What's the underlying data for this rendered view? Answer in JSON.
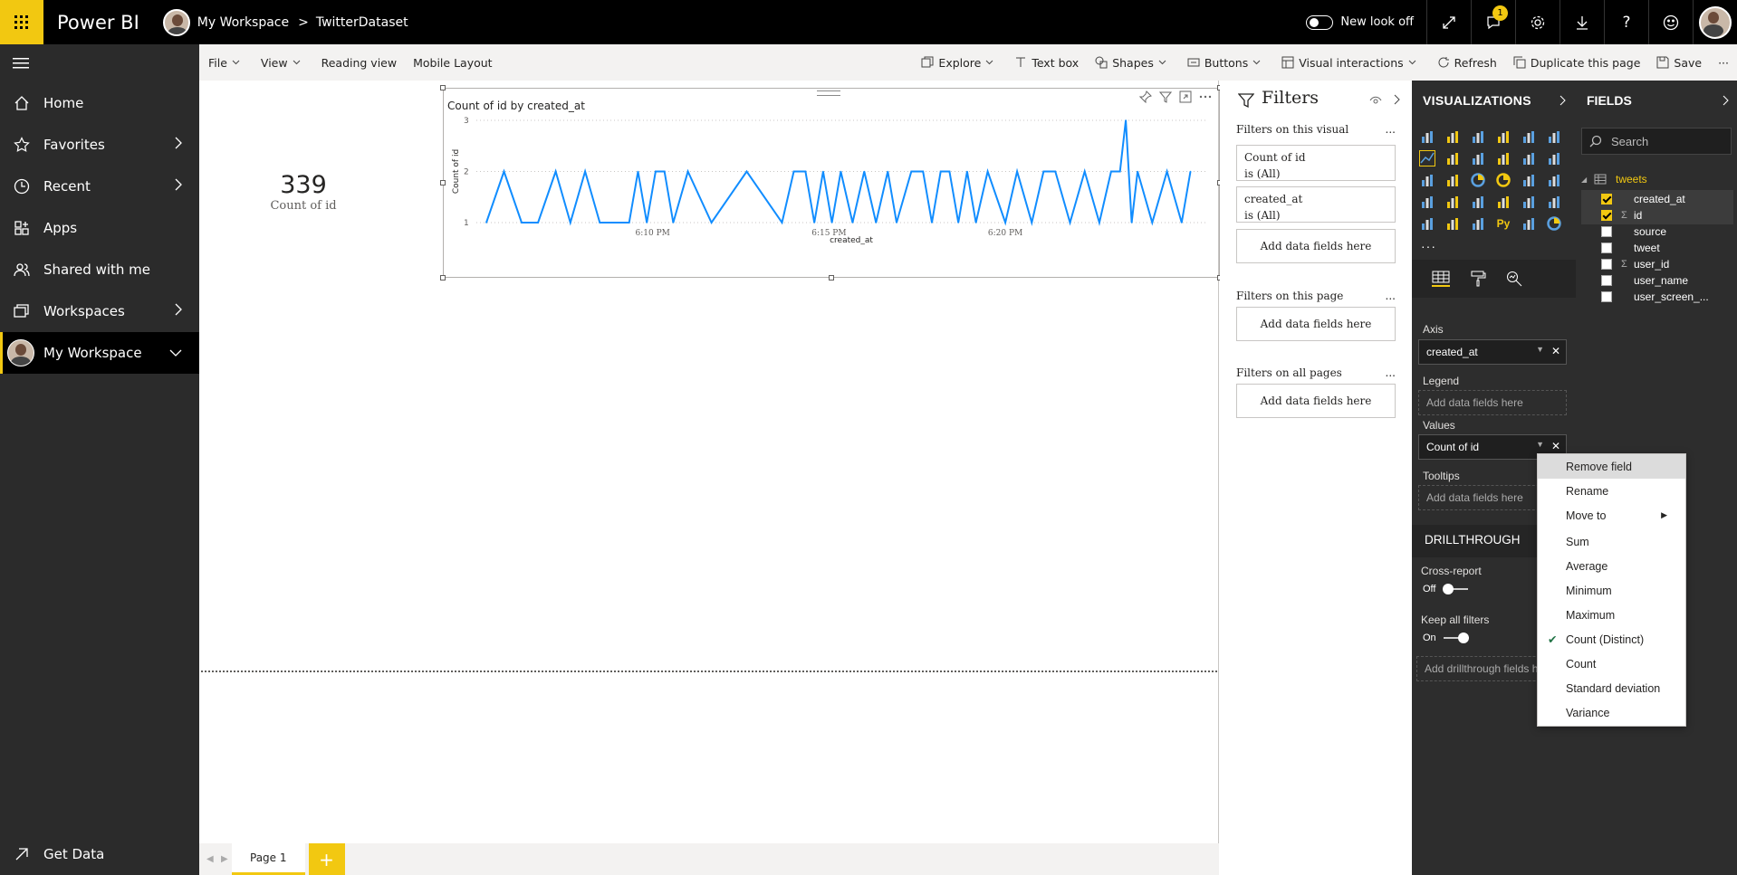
{
  "topbar": {
    "brand": "Power BI",
    "workspace": "My Workspace",
    "separator": ">",
    "dataset": "TwitterDataset",
    "new_look_label": "New look off",
    "notification_count": "1"
  },
  "nav": {
    "items": [
      {
        "label": "Home",
        "icon": "home-icon"
      },
      {
        "label": "Favorites",
        "icon": "star-icon"
      },
      {
        "label": "Recent",
        "icon": "clock-icon"
      },
      {
        "label": "Apps",
        "icon": "apps-icon"
      },
      {
        "label": "Shared with me",
        "icon": "shared-icon"
      },
      {
        "label": "Workspaces",
        "icon": "workspaces-icon"
      },
      {
        "label": "My Workspace",
        "icon": "avatar"
      }
    ],
    "get_data": "Get Data"
  },
  "ribbon": {
    "file": "File",
    "view": "View",
    "reading_view": "Reading view",
    "mobile_layout": "Mobile Layout",
    "explore": "Explore",
    "text_box": "Text box",
    "shapes": "Shapes",
    "buttons": "Buttons",
    "visual_interactions": "Visual interactions",
    "refresh": "Refresh",
    "duplicate": "Duplicate this page",
    "save": "Save",
    "more": "···"
  },
  "card": {
    "value": "339",
    "label": "Count of id"
  },
  "chart_data": {
    "type": "line",
    "title": "Count of id by created_at",
    "xlabel": "created_at",
    "ylabel": "Count of id",
    "yticks": [
      "1",
      "2",
      "3"
    ],
    "xticks": [
      "6:10 PM",
      "6:15 PM",
      "6:20 PM"
    ],
    "ylim": [
      1,
      3
    ],
    "series_color": "#118dff",
    "x": [
      "6:05:17",
      "6:05:47",
      "6:06:17",
      "6:06:45",
      "6:07:15",
      "6:07:40",
      "6:08:05",
      "6:08:30",
      "6:09:20",
      "6:09:35",
      "6:09:50",
      "6:10:05",
      "6:10:20",
      "6:10:35",
      "6:11:00",
      "6:11:40",
      "6:12:40",
      "6:13:40",
      "6:14:00",
      "6:14:20",
      "6:14:35",
      "6:14:50",
      "6:15:05",
      "6:15:20",
      "6:15:40",
      "6:16:00",
      "6:16:20",
      "6:16:40",
      "6:16:55",
      "6:17:20",
      "6:17:40",
      "6:17:55",
      "6:18:10",
      "6:18:25",
      "6:18:40",
      "6:18:55",
      "6:19:10",
      "6:19:30",
      "6:20:00",
      "6:20:20",
      "6:20:45",
      "6:21:05",
      "6:21:25",
      "6:21:50",
      "6:22:15",
      "6:22:40",
      "6:23:00",
      "6:23:15",
      "6:23:25",
      "6:23:35",
      "6:23:45",
      "6:24:10",
      "6:24:35",
      "6:25:00",
      "6:25:15"
    ],
    "values": [
      1,
      2,
      1,
      1,
      2,
      1,
      2,
      1,
      1,
      2,
      1,
      2,
      2,
      1,
      2,
      1,
      2,
      1,
      2,
      2,
      1,
      2,
      1,
      2,
      1,
      2,
      1,
      2,
      1,
      2,
      2,
      1,
      2,
      2,
      1,
      2,
      1,
      2,
      1,
      2,
      1,
      2,
      2,
      1,
      2,
      1,
      2,
      2,
      3,
      1,
      2,
      1,
      2,
      1,
      2
    ]
  },
  "filters": {
    "title": "Filters",
    "on_visual": "Filters on this visual",
    "card1_name": "Count of id",
    "card1_state": "is (All)",
    "card2_name": "created_at",
    "card2_state": "is (All)",
    "add_fields": "Add data fields here",
    "on_page": "Filters on this page",
    "on_all": "Filters on all pages",
    "dots": "..."
  },
  "viz": {
    "title": "VISUALIZATIONS",
    "axis_label": "Axis",
    "axis_value": "created_at",
    "legend_label": "Legend",
    "legend_placeholder": "Add data fields here",
    "values_label": "Values",
    "values_value": "Count of id",
    "tooltips_label": "Tooltips",
    "tooltips_placeholder": "Add data fields here",
    "drillthrough": "DRILLTHROUGH",
    "cross_report": "Cross-report",
    "off": "Off",
    "keep_filters": "Keep all filters",
    "on": "On",
    "drill_placeholder": "Add drillthrough fields h",
    "more": "···"
  },
  "fields": {
    "title": "FIELDS",
    "search_placeholder": "Search",
    "table": "tweets",
    "items": [
      {
        "name": "created_at",
        "checked": true,
        "sigma": false
      },
      {
        "name": "id",
        "checked": true,
        "sigma": true
      },
      {
        "name": "source",
        "checked": false,
        "sigma": false
      },
      {
        "name": "tweet",
        "checked": false,
        "sigma": false
      },
      {
        "name": "user_id",
        "checked": false,
        "sigma": true
      },
      {
        "name": "user_name",
        "checked": false,
        "sigma": false
      },
      {
        "name": "user_screen_...",
        "checked": false,
        "sigma": false
      }
    ]
  },
  "context_menu": {
    "items": [
      "Remove field",
      "Rename",
      "Move to",
      "Sum",
      "Average",
      "Minimum",
      "Maximum",
      "Count (Distinct)",
      "Count",
      "Standard deviation",
      "Variance"
    ],
    "checked": "Count (Distinct)"
  },
  "tabs": {
    "page1": "Page 1",
    "add": "+"
  },
  "colors": {
    "accent": "#f2c811",
    "line": "#118dff",
    "nav_bg": "#2b2b2b",
    "pane_bg": "#2d2d2d"
  }
}
